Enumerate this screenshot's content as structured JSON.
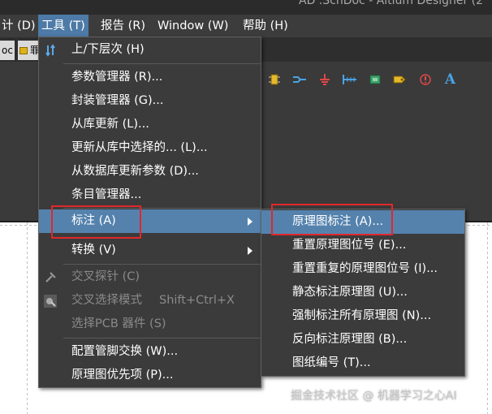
{
  "window": {
    "title_fragment": "AD .SchDoc - Altium Designer (2"
  },
  "menubar": {
    "items": [
      {
        "label": "计 (D)"
      },
      {
        "label": "工具 (T)"
      },
      {
        "label": "报告 (R)"
      },
      {
        "label": "Window (W)"
      },
      {
        "label": "帮助 (H)"
      }
    ],
    "active_index": 1
  },
  "tabs": [
    {
      "label": "oc"
    },
    {
      "label": "罪"
    }
  ],
  "tools_menu": {
    "items": [
      {
        "label": "上/下层次 (H)",
        "icon": "hierarchy-arrows-icon"
      },
      {
        "label": "参数管理器 (R)..."
      },
      {
        "label": "封装管理器 (G)..."
      },
      {
        "label": "从库更新 (L)..."
      },
      {
        "label": "更新从库中选择的... (L)..."
      },
      {
        "label": "从数据库更新参数 (D)..."
      },
      {
        "label": "条目管理器..."
      },
      {
        "label": "标注 (A)",
        "submenu": true,
        "highlighted": true
      },
      {
        "label": "转换 (V)",
        "submenu": true
      },
      {
        "label": "交叉探针 (C)",
        "disabled": true,
        "icon": "cross-probe-icon"
      },
      {
        "label": "交叉选择模式",
        "shortcut": "Shift+Ctrl+X",
        "disabled": true,
        "icon": "cross-select-icon"
      },
      {
        "label": "选择PCB 器件 (S)",
        "disabled": true
      },
      {
        "label": "配置管脚交换 (W)..."
      },
      {
        "label": "原理图优先项 (P)..."
      }
    ]
  },
  "annotate_submenu": {
    "items": [
      {
        "label": "原理图标注 (A)...",
        "highlighted": true
      },
      {
        "label": "重置原理图位号 (E)..."
      },
      {
        "label": "重置重复的原理图位号 (I)..."
      },
      {
        "label": "静态标注原理图 (U)..."
      },
      {
        "label": "强制标注所有原理图 (N)..."
      },
      {
        "label": "反向标注原理图 (B)..."
      },
      {
        "label": "图纸编号 (T)..."
      }
    ]
  },
  "toolbar": {
    "icons": [
      "component-icon",
      "bus-icon",
      "ground-icon",
      "port-icon",
      "device-icon",
      "net-label-icon",
      "probe-icon",
      "text-icon"
    ],
    "text_icon_glyph": "A"
  },
  "colors": {
    "menu_bg": "#3b3b3b",
    "highlight": "#5582ad",
    "active_menu": "#4d7aa6",
    "annotation_box": "#e0282a"
  },
  "watermark": "掘金技术社区 @ 机器学习之心AI"
}
